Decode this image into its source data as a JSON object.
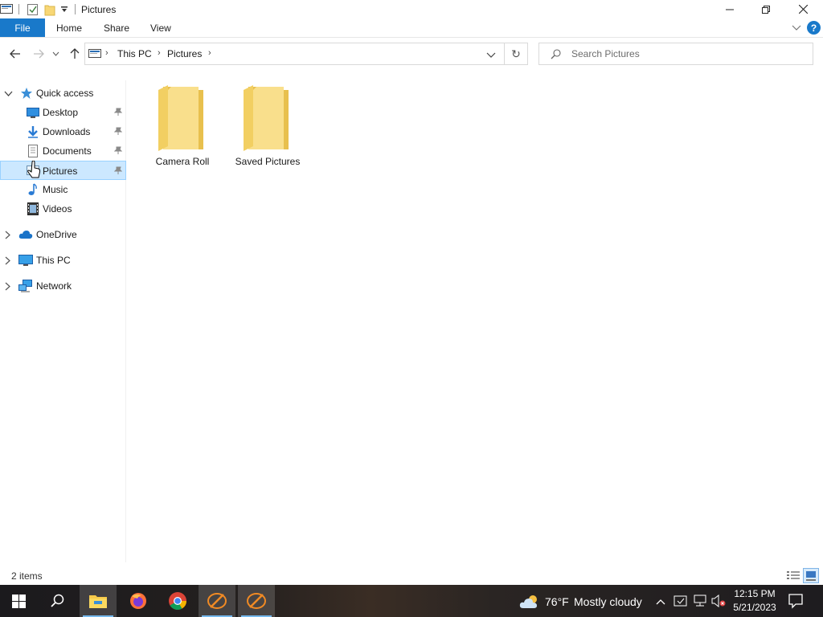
{
  "window": {
    "title": "Pictures",
    "minimize_icon": "minimize-icon",
    "maximize_icon": "restore-icon",
    "close_icon": "close-icon"
  },
  "ribbon": {
    "tabs": [
      {
        "label": "File",
        "active": true
      },
      {
        "label": "Home"
      },
      {
        "label": "Share"
      },
      {
        "label": "View"
      }
    ],
    "help_label": "?",
    "accent_color": "#1979ca"
  },
  "address": {
    "crumbs": [
      "This PC",
      "Pictures"
    ],
    "refresh_glyph": "↻"
  },
  "search": {
    "placeholder": "Search Pictures"
  },
  "nav_pane": {
    "quick_access": "Quick access",
    "items": [
      {
        "label": "Desktop",
        "icon": "desktop-icon",
        "pinned": true
      },
      {
        "label": "Downloads",
        "icon": "downloads-icon",
        "pinned": true
      },
      {
        "label": "Documents",
        "icon": "documents-icon",
        "pinned": true
      },
      {
        "label": "Pictures",
        "icon": "pictures-icon",
        "pinned": true,
        "selected": true
      },
      {
        "label": "Music",
        "icon": "music-icon"
      },
      {
        "label": "Videos",
        "icon": "videos-icon"
      }
    ],
    "roots": [
      {
        "label": "OneDrive",
        "icon": "onedrive-icon"
      },
      {
        "label": "This PC",
        "icon": "this-pc-icon"
      },
      {
        "label": "Network",
        "icon": "network-icon"
      }
    ]
  },
  "content": {
    "folders": [
      {
        "name": "Camera Roll"
      },
      {
        "name": "Saved Pictures"
      }
    ]
  },
  "status": {
    "item_count": "2 items"
  },
  "taskbar": {
    "apps": [
      "start",
      "search",
      "file-explorer",
      "firefox",
      "chrome",
      "app-1",
      "app-2"
    ],
    "weather_temp": "76°F",
    "weather_condition": "Mostly cloudy",
    "time": "12:15 PM",
    "date": "5/21/2023"
  }
}
